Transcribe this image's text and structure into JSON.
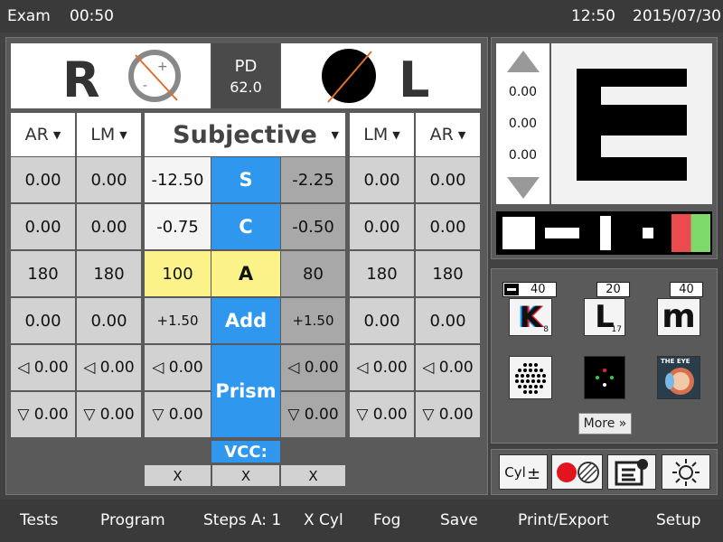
{
  "topbar": {
    "mode": "Exam",
    "timer": "00:50",
    "clock": "12:50",
    "date": "2015/07/30"
  },
  "eyes": {
    "right_label": "R",
    "left_label": "L",
    "pd_label": "PD",
    "pd_value": "62.0"
  },
  "columns": {
    "right_ar": "AR",
    "right_lm": "LM",
    "subjective": "Subjective",
    "left_lm": "LM",
    "left_ar": "AR"
  },
  "rows": [
    {
      "label": "S",
      "r_ar": "0.00",
      "r_lm": "0.00",
      "r_subj": "-12.50",
      "l_subj": "-2.25",
      "l_lm": "0.00",
      "l_ar": "0.00"
    },
    {
      "label": "C",
      "r_ar": "0.00",
      "r_lm": "0.00",
      "r_subj": "-0.75",
      "l_subj": "-0.50",
      "l_lm": "0.00",
      "l_ar": "0.00"
    },
    {
      "label": "A",
      "r_ar": "180",
      "r_lm": "180",
      "r_subj": "100",
      "l_subj": "80",
      "l_lm": "180",
      "l_ar": "180"
    },
    {
      "label": "Add",
      "r_ar": "0.00",
      "r_lm": "0.00",
      "r_subj": "+1.50",
      "l_subj": "+1.50",
      "l_lm": "0.00",
      "l_ar": "0.00"
    }
  ],
  "prism": {
    "label": "Prism",
    "horizontal": {
      "r_ar": "◁ 0.00",
      "r_lm": "◁ 0.00",
      "r_subj": "◁ 0.00",
      "l_subj": "◁ 0.00",
      "l_lm": "◁ 0.00",
      "l_ar": "◁ 0.00"
    },
    "vertical": {
      "r_ar": "▽ 0.00",
      "r_lm": "▽ 0.00",
      "r_subj": "▽ 0.00",
      "l_subj": "▽ 0.00",
      "l_lm": "▽ 0.00",
      "l_ar": "▽ 0.00"
    }
  },
  "vcc": {
    "label": "VCC:",
    "cells": [
      "X",
      "X",
      "X"
    ]
  },
  "acuity": {
    "values": [
      "0.00",
      "0.00",
      "0.00"
    ],
    "letter": "E"
  },
  "tests": {
    "badges": [
      "40",
      "20",
      "40"
    ],
    "k_letter": "K",
    "k_sub": "8",
    "l_letter": "L",
    "l_sub": "17",
    "m_letter": "m",
    "eye_label": "THE EYE",
    "more_label": "More »"
  },
  "tools": {
    "cyl_label": "Cyl"
  },
  "colors": {
    "accent_blue": "#2f97ee",
    "highlight_yellow": "#fbf38a",
    "cross_orange": "#e0702a"
  },
  "bottombar": [
    "Tests",
    "Program",
    "Steps A: 1",
    "X Cyl",
    "Fog",
    "Save",
    "Print/Export",
    "Setup"
  ]
}
